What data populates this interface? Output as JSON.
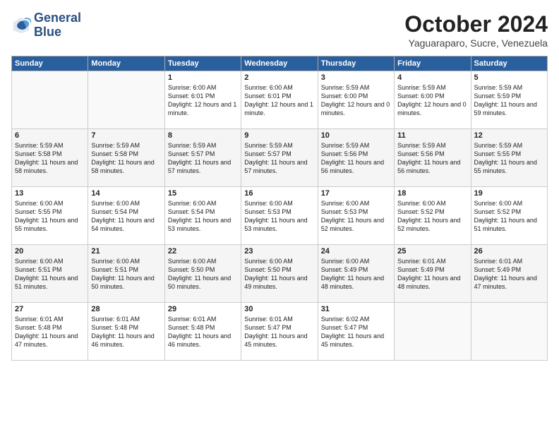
{
  "header": {
    "logo_line1": "General",
    "logo_line2": "Blue",
    "month": "October 2024",
    "location": "Yaguaraparo, Sucre, Venezuela"
  },
  "weekdays": [
    "Sunday",
    "Monday",
    "Tuesday",
    "Wednesday",
    "Thursday",
    "Friday",
    "Saturday"
  ],
  "weeks": [
    [
      {
        "day": "",
        "sunrise": "",
        "sunset": "",
        "daylight": ""
      },
      {
        "day": "",
        "sunrise": "",
        "sunset": "",
        "daylight": ""
      },
      {
        "day": "1",
        "sunrise": "Sunrise: 6:00 AM",
        "sunset": "Sunset: 6:01 PM",
        "daylight": "Daylight: 12 hours and 1 minute."
      },
      {
        "day": "2",
        "sunrise": "Sunrise: 6:00 AM",
        "sunset": "Sunset: 6:01 PM",
        "daylight": "Daylight: 12 hours and 1 minute."
      },
      {
        "day": "3",
        "sunrise": "Sunrise: 5:59 AM",
        "sunset": "Sunset: 6:00 PM",
        "daylight": "Daylight: 12 hours and 0 minutes."
      },
      {
        "day": "4",
        "sunrise": "Sunrise: 5:59 AM",
        "sunset": "Sunset: 6:00 PM",
        "daylight": "Daylight: 12 hours and 0 minutes."
      },
      {
        "day": "5",
        "sunrise": "Sunrise: 5:59 AM",
        "sunset": "Sunset: 5:59 PM",
        "daylight": "Daylight: 11 hours and 59 minutes."
      }
    ],
    [
      {
        "day": "6",
        "sunrise": "Sunrise: 5:59 AM",
        "sunset": "Sunset: 5:58 PM",
        "daylight": "Daylight: 11 hours and 58 minutes."
      },
      {
        "day": "7",
        "sunrise": "Sunrise: 5:59 AM",
        "sunset": "Sunset: 5:58 PM",
        "daylight": "Daylight: 11 hours and 58 minutes."
      },
      {
        "day": "8",
        "sunrise": "Sunrise: 5:59 AM",
        "sunset": "Sunset: 5:57 PM",
        "daylight": "Daylight: 11 hours and 57 minutes."
      },
      {
        "day": "9",
        "sunrise": "Sunrise: 5:59 AM",
        "sunset": "Sunset: 5:57 PM",
        "daylight": "Daylight: 11 hours and 57 minutes."
      },
      {
        "day": "10",
        "sunrise": "Sunrise: 5:59 AM",
        "sunset": "Sunset: 5:56 PM",
        "daylight": "Daylight: 11 hours and 56 minutes."
      },
      {
        "day": "11",
        "sunrise": "Sunrise: 5:59 AM",
        "sunset": "Sunset: 5:56 PM",
        "daylight": "Daylight: 11 hours and 56 minutes."
      },
      {
        "day": "12",
        "sunrise": "Sunrise: 5:59 AM",
        "sunset": "Sunset: 5:55 PM",
        "daylight": "Daylight: 11 hours and 55 minutes."
      }
    ],
    [
      {
        "day": "13",
        "sunrise": "Sunrise: 6:00 AM",
        "sunset": "Sunset: 5:55 PM",
        "daylight": "Daylight: 11 hours and 55 minutes."
      },
      {
        "day": "14",
        "sunrise": "Sunrise: 6:00 AM",
        "sunset": "Sunset: 5:54 PM",
        "daylight": "Daylight: 11 hours and 54 minutes."
      },
      {
        "day": "15",
        "sunrise": "Sunrise: 6:00 AM",
        "sunset": "Sunset: 5:54 PM",
        "daylight": "Daylight: 11 hours and 53 minutes."
      },
      {
        "day": "16",
        "sunrise": "Sunrise: 6:00 AM",
        "sunset": "Sunset: 5:53 PM",
        "daylight": "Daylight: 11 hours and 53 minutes."
      },
      {
        "day": "17",
        "sunrise": "Sunrise: 6:00 AM",
        "sunset": "Sunset: 5:53 PM",
        "daylight": "Daylight: 11 hours and 52 minutes."
      },
      {
        "day": "18",
        "sunrise": "Sunrise: 6:00 AM",
        "sunset": "Sunset: 5:52 PM",
        "daylight": "Daylight: 11 hours and 52 minutes."
      },
      {
        "day": "19",
        "sunrise": "Sunrise: 6:00 AM",
        "sunset": "Sunset: 5:52 PM",
        "daylight": "Daylight: 11 hours and 51 minutes."
      }
    ],
    [
      {
        "day": "20",
        "sunrise": "Sunrise: 6:00 AM",
        "sunset": "Sunset: 5:51 PM",
        "daylight": "Daylight: 11 hours and 51 minutes."
      },
      {
        "day": "21",
        "sunrise": "Sunrise: 6:00 AM",
        "sunset": "Sunset: 5:51 PM",
        "daylight": "Daylight: 11 hours and 50 minutes."
      },
      {
        "day": "22",
        "sunrise": "Sunrise: 6:00 AM",
        "sunset": "Sunset: 5:50 PM",
        "daylight": "Daylight: 11 hours and 50 minutes."
      },
      {
        "day": "23",
        "sunrise": "Sunrise: 6:00 AM",
        "sunset": "Sunset: 5:50 PM",
        "daylight": "Daylight: 11 hours and 49 minutes."
      },
      {
        "day": "24",
        "sunrise": "Sunrise: 6:00 AM",
        "sunset": "Sunset: 5:49 PM",
        "daylight": "Daylight: 11 hours and 48 minutes."
      },
      {
        "day": "25",
        "sunrise": "Sunrise: 6:01 AM",
        "sunset": "Sunset: 5:49 PM",
        "daylight": "Daylight: 11 hours and 48 minutes."
      },
      {
        "day": "26",
        "sunrise": "Sunrise: 6:01 AM",
        "sunset": "Sunset: 5:49 PM",
        "daylight": "Daylight: 11 hours and 47 minutes."
      }
    ],
    [
      {
        "day": "27",
        "sunrise": "Sunrise: 6:01 AM",
        "sunset": "Sunset: 5:48 PM",
        "daylight": "Daylight: 11 hours and 47 minutes."
      },
      {
        "day": "28",
        "sunrise": "Sunrise: 6:01 AM",
        "sunset": "Sunset: 5:48 PM",
        "daylight": "Daylight: 11 hours and 46 minutes."
      },
      {
        "day": "29",
        "sunrise": "Sunrise: 6:01 AM",
        "sunset": "Sunset: 5:48 PM",
        "daylight": "Daylight: 11 hours and 46 minutes."
      },
      {
        "day": "30",
        "sunrise": "Sunrise: 6:01 AM",
        "sunset": "Sunset: 5:47 PM",
        "daylight": "Daylight: 11 hours and 45 minutes."
      },
      {
        "day": "31",
        "sunrise": "Sunrise: 6:02 AM",
        "sunset": "Sunset: 5:47 PM",
        "daylight": "Daylight: 11 hours and 45 minutes."
      },
      {
        "day": "",
        "sunrise": "",
        "sunset": "",
        "daylight": ""
      },
      {
        "day": "",
        "sunrise": "",
        "sunset": "",
        "daylight": ""
      }
    ]
  ]
}
